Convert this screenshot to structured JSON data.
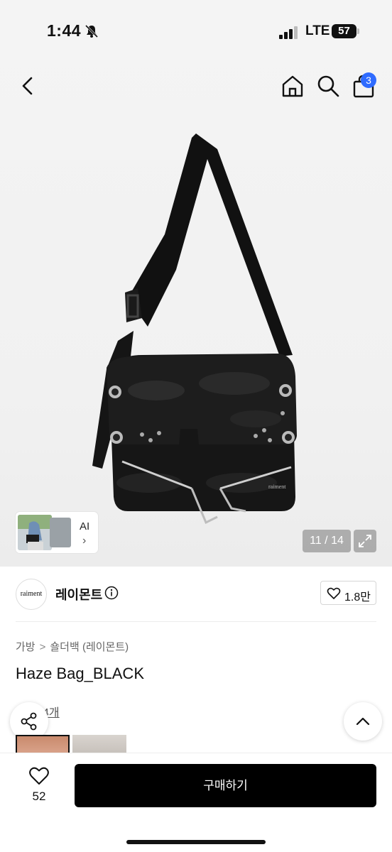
{
  "status_bar": {
    "time": "1:44",
    "network": "LTE",
    "battery_level": "57"
  },
  "nav": {
    "cart_badge": "3",
    "icons": [
      "back-icon",
      "home-icon",
      "search-icon",
      "cart-icon"
    ]
  },
  "gallery": {
    "ai_label": "AI",
    "ai_chevron": "›",
    "page_counter": "11 / 14"
  },
  "brand": {
    "logo_text": "raiment",
    "name": "레이몬트",
    "like_count": "1.8만"
  },
  "product": {
    "breadcrumb": [
      "가방",
      "숄더백 (레이몬트)"
    ],
    "breadcrumb_separator": ">",
    "title": "Haze Bag_BLACK",
    "review_count_partial": "4개"
  },
  "bottom_bar": {
    "wish_count": "52",
    "buy_label": "구매하기"
  },
  "colors": {
    "accent_badge": "#2f6bff",
    "buy_button": "#000000"
  }
}
